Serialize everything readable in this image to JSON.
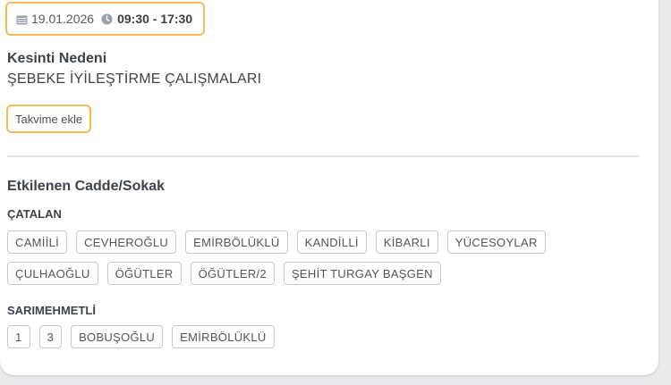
{
  "outage": {
    "date": "19.01.2026",
    "time": "09:30 - 17:30",
    "reason_label": "Kesinti Nedeni",
    "reason_value": "ŞEBEKE İYİLEŞTİRME ÇALIŞMALARI",
    "calendar_button": "Takvime ekle"
  },
  "affected": {
    "title": "Etkilenen Cadde/Sokak",
    "districts": [
      {
        "name": "ÇATALAN",
        "rows": [
          [
            "CAMİİLİ",
            "CEVHEROĞLU",
            "EMİRBÖLÜKLÜ",
            "KANDİLLİ",
            "KİBARLI",
            "YÜCESOYLAR"
          ],
          [
            "ÇULHAOĞLU",
            "ÖĞÜTLER",
            "ÖĞÜTLER/2",
            "ŞEHİT TURGAY BAŞGEN"
          ]
        ]
      },
      {
        "name": "SARIMEHMETLİ",
        "rows": [
          [
            "1",
            "3",
            "BOBUŞOĞLU",
            "EMİRBÖLÜKLÜ"
          ]
        ]
      }
    ]
  },
  "colors": {
    "accent": "#f2bc55",
    "text": "#3e434b",
    "tag_border": "#c5c9d1"
  }
}
